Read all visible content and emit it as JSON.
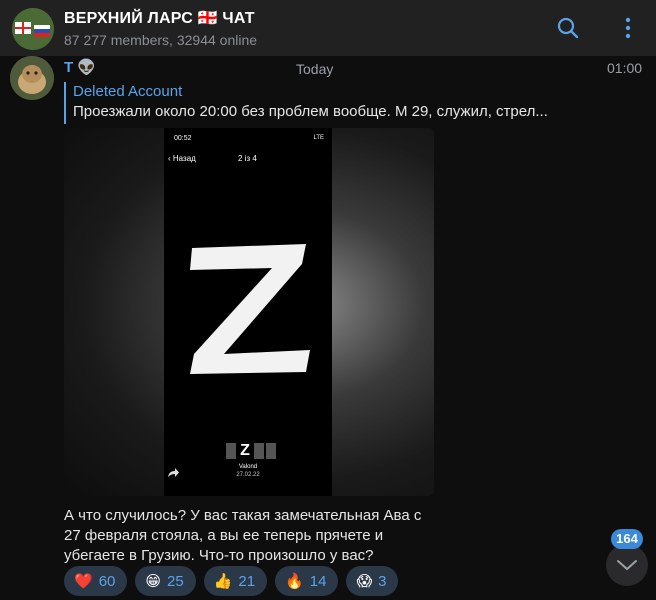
{
  "header": {
    "title": "ВЕРХНИЙ ЛАРС 🇬🇪 ЧАТ",
    "subtitle": "87 277 members, 32944 online"
  },
  "message": {
    "sender": "T 👽",
    "date_chip": "Today",
    "time": "01:00",
    "reply": {
      "author": "Deleted Account",
      "text": "Проезжали около 20:00 без проблем вообще. М 29, служил, стрел..."
    },
    "media": {
      "status_time": "00:52",
      "status_right": "LTE",
      "back_label": "Назад",
      "counter": "2 із 4",
      "thumb_letter": "Z",
      "name": "Valond",
      "date": "27.02.22"
    },
    "caption": "А что случилось? У вас такая замечательная Ава с 27 февраля стояла, а вы ее теперь прячете и убегаете в Грузию. Что-то произошло у вас?"
  },
  "reactions": [
    {
      "emoji": "❤️",
      "count": "60"
    },
    {
      "emoji": "😁",
      "count": "25"
    },
    {
      "emoji": "👍",
      "count": "21"
    },
    {
      "emoji": "🔥",
      "count": "14"
    },
    {
      "emoji": "😱",
      "count": "3"
    }
  ],
  "unread_count": "164",
  "colors": {
    "accent": "#5aa3e8",
    "header_bg": "#212121",
    "bg": "#0e0e0f",
    "reaction_bg": "#2b3848",
    "badge": "#3a8ad8"
  }
}
